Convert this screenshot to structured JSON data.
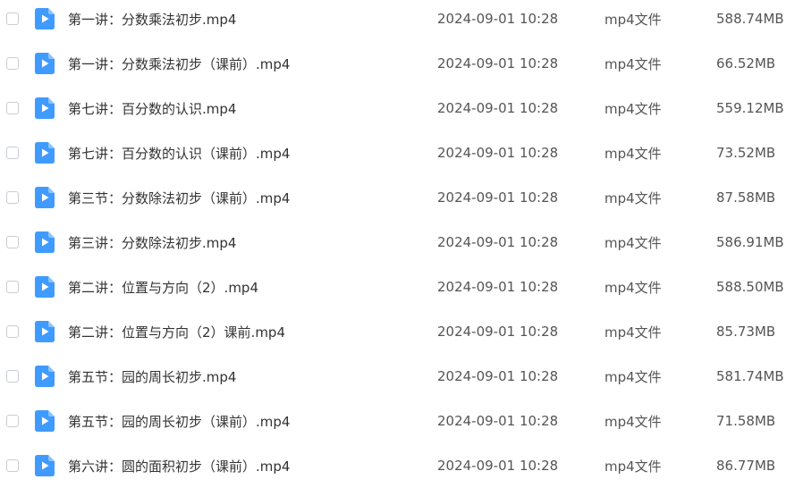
{
  "icons": {
    "row_icon": "video-file-icon",
    "icon_color": "#3f9bff"
  },
  "files": [
    {
      "name": "第一讲：分数乘法初步.mp4",
      "date": "2024-09-01 10:28",
      "type": "mp4文件",
      "size": "588.74MB"
    },
    {
      "name": "第一讲：分数乘法初步（课前）.mp4",
      "date": "2024-09-01 10:28",
      "type": "mp4文件",
      "size": "66.52MB"
    },
    {
      "name": "第七讲：百分数的认识.mp4",
      "date": "2024-09-01 10:28",
      "type": "mp4文件",
      "size": "559.12MB"
    },
    {
      "name": "第七讲：百分数的认识（课前）.mp4",
      "date": "2024-09-01 10:28",
      "type": "mp4文件",
      "size": "73.52MB"
    },
    {
      "name": "第三节：分数除法初步（课前）.mp4",
      "date": "2024-09-01 10:28",
      "type": "mp4文件",
      "size": "87.58MB"
    },
    {
      "name": "第三讲：分数除法初步.mp4",
      "date": "2024-09-01 10:28",
      "type": "mp4文件",
      "size": "586.91MB"
    },
    {
      "name": "第二讲：位置与方向（2）.mp4",
      "date": "2024-09-01 10:28",
      "type": "mp4文件",
      "size": "588.50MB"
    },
    {
      "name": "第二讲：位置与方向（2）课前.mp4",
      "date": "2024-09-01 10:28",
      "type": "mp4文件",
      "size": "85.73MB"
    },
    {
      "name": "第五节：园的周长初步.mp4",
      "date": "2024-09-01 10:28",
      "type": "mp4文件",
      "size": "581.74MB"
    },
    {
      "name": "第五节：园的周长初步（课前）.mp4",
      "date": "2024-09-01 10:28",
      "type": "mp4文件",
      "size": "71.58MB"
    },
    {
      "name": "第六讲：圆的面积初步（课前）.mp4",
      "date": "2024-09-01 10:28",
      "type": "mp4文件",
      "size": "86.77MB"
    }
  ]
}
